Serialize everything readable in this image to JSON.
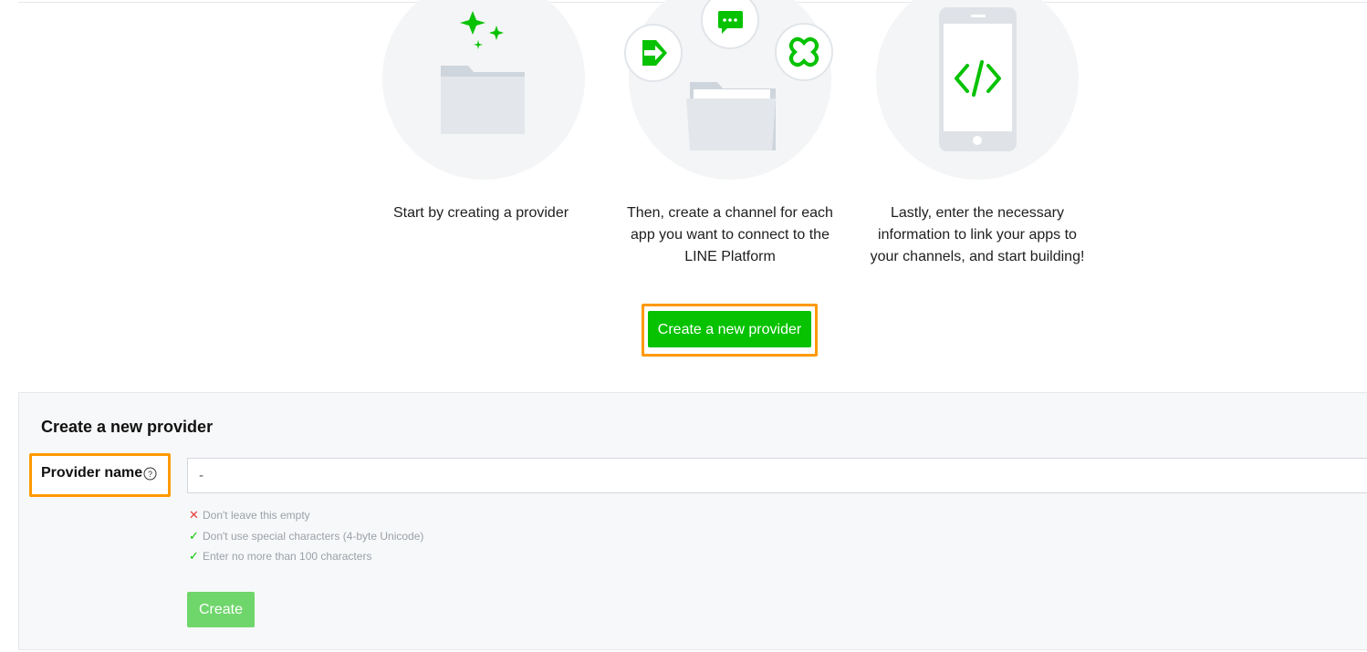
{
  "steps": [
    {
      "text_line1": "Start by creating a provider",
      "text_line2": "",
      "text_line3": ""
    },
    {
      "text_line1": "Then, create a channel for each",
      "text_line2": "app you want to connect to the",
      "text_line3": "LINE Platform"
    },
    {
      "text_line1": "Lastly, enter the necessary",
      "text_line2": "information to link your apps to",
      "text_line3": "your channels, and start building!"
    }
  ],
  "cta": {
    "label": "Create a new provider"
  },
  "form": {
    "title": "Create a new provider",
    "field_label": "Provider name",
    "input_value": "-",
    "rules": [
      {
        "status": "error",
        "text": "Don't leave this empty"
      },
      {
        "status": "ok",
        "text": "Don't use special characters (4-byte Unicode)"
      },
      {
        "status": "ok",
        "text": "Enter no more than 100 characters"
      }
    ],
    "submit_label": "Create"
  },
  "colors": {
    "brand_green": "#06c200",
    "highlight": "#ff9900",
    "disabled_green": "#6fd66b"
  }
}
